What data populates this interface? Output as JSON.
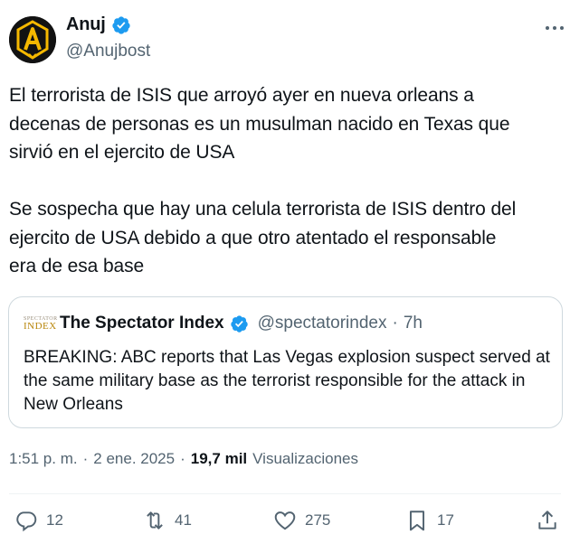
{
  "author": {
    "name": "Anuj",
    "handle": "@Anujbost",
    "verified": true,
    "avatar_colors": {
      "bg": "#121212",
      "fg": "#f5b800"
    }
  },
  "tweet": {
    "text": "El terrorista de ISIS que arroyó ayer en nueva orleans a\ndecenas de personas es un musulman nacido en Texas que\nsirvió en el ejercito de USA\n\nSe sospecha que hay una celula terrorista de ISIS dentro del\nejercito de USA debido a que otro atentado el responsable\nera de esa base"
  },
  "quoted": {
    "logo_line1": "SPECTATOR",
    "logo_line2": "INDEX",
    "name": "The Spectator Index",
    "handle": "@spectatorindex",
    "separator": "·",
    "time": "7h",
    "verified": true,
    "text": "BREAKING: ABC reports that Las Vegas explosion suspect served at the same military base as the terrorist responsible for the attack in New Orleans"
  },
  "meta": {
    "time": "1:51 p. m.",
    "dot": "·",
    "date": "2 ene. 2025",
    "views_count": "19,7 mil",
    "views_label": "Visualizaciones"
  },
  "actions": {
    "replies": "12",
    "reposts": "41",
    "likes": "275",
    "bookmarks": "17"
  },
  "colors": {
    "verified": "#1d9bf0",
    "secondary_text": "#536471",
    "border": "#cfd9de"
  }
}
